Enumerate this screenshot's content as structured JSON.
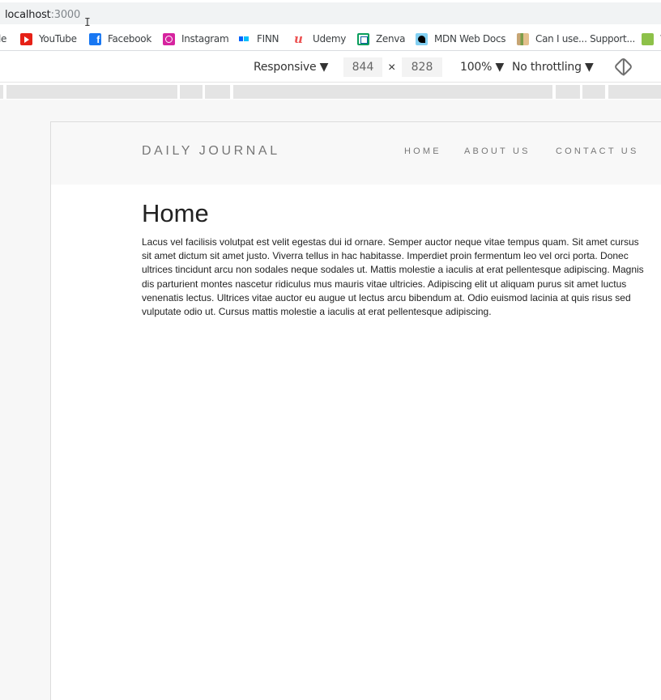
{
  "browser": {
    "url_host": "localhost",
    "url_port": ":3000"
  },
  "bookmarks": [
    {
      "label": "le",
      "icon": "google-icon"
    },
    {
      "label": "YouTube",
      "icon": "youtube-icon"
    },
    {
      "label": "Facebook",
      "icon": "facebook-icon"
    },
    {
      "label": "Instagram",
      "icon": "instagram-icon"
    },
    {
      "label": "FINN",
      "icon": "finn-icon"
    },
    {
      "label": "Udemy",
      "icon": "udemy-icon"
    },
    {
      "label": "Zenva",
      "icon": "zenva-icon"
    },
    {
      "label": "MDN Web Docs",
      "icon": "mdn-icon"
    },
    {
      "label": "Can I use... Support...",
      "icon": "caniuse-icon"
    },
    {
      "label": "W",
      "icon": "w3schools-icon"
    }
  ],
  "devtools": {
    "device_mode": "Responsive ▼",
    "width": "844",
    "times": "×",
    "height": "828",
    "zoom": "100% ▼",
    "throttling": "No throttling ▼"
  },
  "site": {
    "brand": "DAILY JOURNAL",
    "nav": {
      "home": "HOME",
      "about": "ABOUT US",
      "contact": "CONTACT US"
    },
    "page_title": "Home",
    "page_body": "Lacus vel facilisis volutpat est velit egestas dui id ornare. Semper auctor neque vitae tempus quam. Sit amet cursus sit amet dictum sit amet justo. Viverra tellus in hac habitasse. Imperdiet proin fermentum leo vel orci porta. Donec ultrices tincidunt arcu non sodales neque sodales ut. Mattis molestie a iaculis at erat pellentesque adipiscing. Magnis dis parturient montes nascetur ridiculus mus mauris vitae ultricies. Adipiscing elit ut aliquam purus sit amet luctus venenatis lectus. Ultrices vitae auctor eu augue ut lectus arcu bibendum at. Odio euismod lacinia at quis risus sed vulputate odio ut. Cursus mattis molestie a iaculis at erat pellentesque adipiscing."
  }
}
